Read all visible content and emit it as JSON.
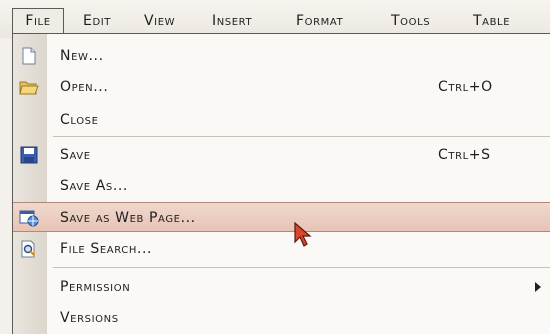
{
  "menubar": {
    "items": [
      {
        "label": "File",
        "selected": true
      },
      {
        "label": "Edit"
      },
      {
        "label": "View"
      },
      {
        "label": "Insert"
      },
      {
        "label": "Format"
      },
      {
        "label": "Tools"
      },
      {
        "label": "Table"
      }
    ]
  },
  "file_menu": {
    "items": [
      {
        "label": "New...",
        "icon": "new-document-icon"
      },
      {
        "label": "Open...",
        "shortcut": "Ctrl+O",
        "icon": "open-folder-icon"
      },
      {
        "label": "Close"
      },
      {
        "label": "Save",
        "shortcut": "Ctrl+S",
        "icon": "floppy-disk-icon"
      },
      {
        "label": "Save As..."
      },
      {
        "label": "Save as Web Page...",
        "icon": "web-page-icon",
        "highlighted": true
      },
      {
        "label": "File Search...",
        "icon": "file-search-icon"
      },
      {
        "label": "Permission",
        "has_submenu": true
      },
      {
        "label": "Versions"
      }
    ]
  },
  "colors": {
    "menu_background": "#fbf9f6",
    "icon_strip": "#dcd6cc",
    "highlight": "#e6c4b6",
    "highlight_border": "#b08878",
    "cursor": "#d9472b"
  }
}
